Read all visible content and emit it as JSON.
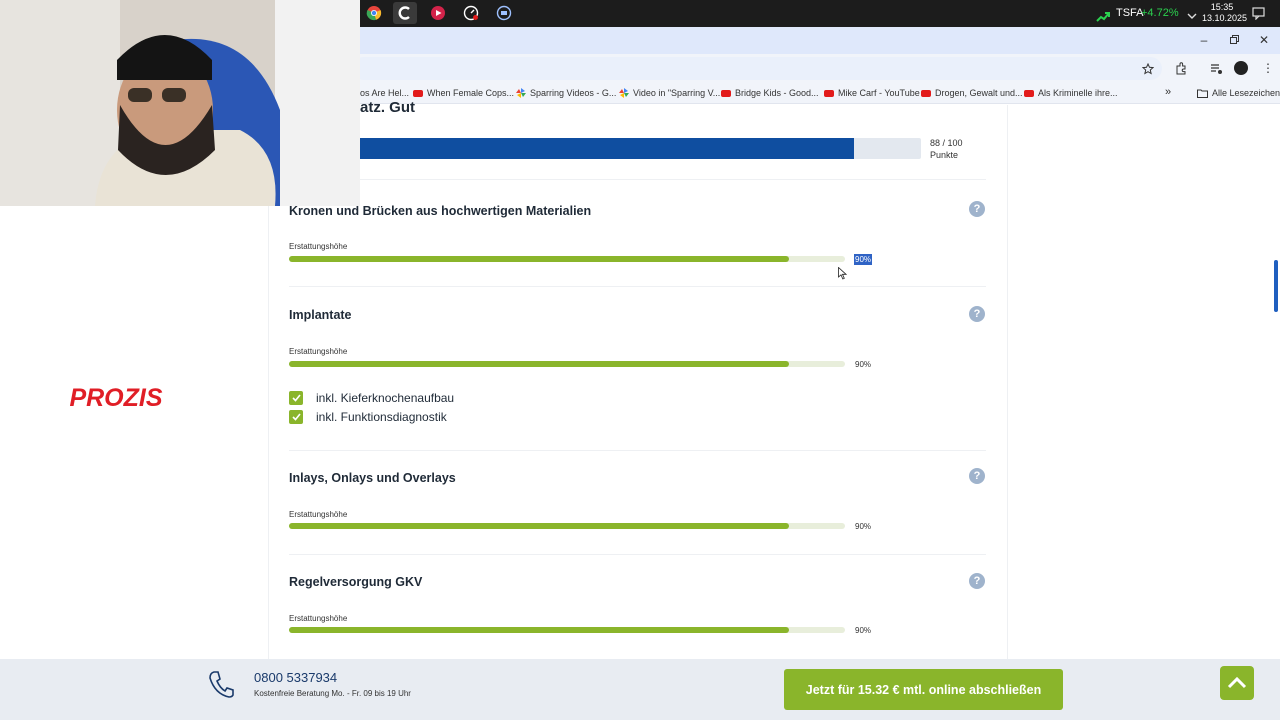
{
  "taskbar": {
    "ticker_symbol": "TSFA",
    "ticker_change": "+4.72%",
    "clock_time": "15:35",
    "clock_date": "13.10.2025"
  },
  "bookmarks": [
    {
      "label": "os Are Hel...",
      "icon": "partial"
    },
    {
      "label": "When Female Cops...",
      "icon": "youtube"
    },
    {
      "label": "Sparring Videos - G...",
      "icon": "pinwheel"
    },
    {
      "label": "Video in \"Sparring V...",
      "icon": "pinwheel"
    },
    {
      "label": "Bridge Kids - Good...",
      "icon": "youtube"
    },
    {
      "label": "Mike Carf - YouTube",
      "icon": "youtube"
    },
    {
      "label": "Drogen, Gewalt und...",
      "icon": "youtube"
    },
    {
      "label": "Als Kriminelle ihre...",
      "icon": "youtube"
    }
  ],
  "bookmarks_more": "»",
  "bookmarks_all": "Alle Lesezeichen",
  "score": {
    "heading_partial": "atz. Gut",
    "text_line1": "88 / 100",
    "text_line2": "Punkte",
    "value": 88,
    "max": 100
  },
  "sections": [
    {
      "title": "Kronen und Brücken aus hochwertigen Materialien",
      "label": "Erstattungshöhe",
      "percent_text": "90%",
      "percent": 90,
      "selected": true
    },
    {
      "title": "Implantate",
      "label": "Erstattungshöhe",
      "percent_text": "90%",
      "percent": 90,
      "selected": false,
      "checks": [
        "inkl. Kieferknochenaufbau",
        "inkl. Funktionsdiagnostik"
      ]
    },
    {
      "title": "Inlays, Onlays und Overlays",
      "label": "Erstattungshöhe",
      "percent_text": "90%",
      "percent": 90,
      "selected": false
    },
    {
      "title": "Regelversorgung GKV",
      "label": "Erstattungshöhe",
      "percent_text": "90%",
      "percent": 90,
      "selected": false
    }
  ],
  "help_symbol": "?",
  "sponsor_logo": "PROZIS",
  "footer": {
    "phone": "0800 5337934",
    "phone_note": "Kostenfreie Beratung Mo. - Fr. 09 bis 19 Uhr",
    "cta_label": "Jetzt für 15.32 € mtl. online abschließen"
  },
  "colors": {
    "accent_green": "#8ab52b",
    "score_blue": "#0f4ea0",
    "footer_bg": "#e8ecf2"
  }
}
